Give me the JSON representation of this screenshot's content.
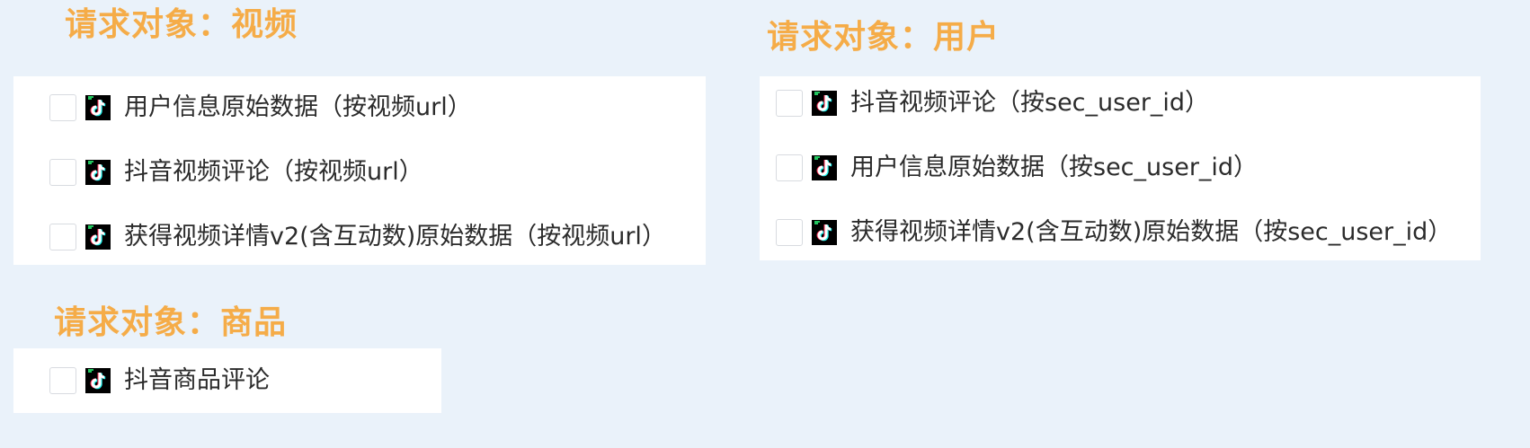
{
  "groups": {
    "video": {
      "title": "请求对象：视频",
      "items": [
        {
          "label": "用户信息原始数据（按视频url）"
        },
        {
          "label": "抖音视频评论（按视频url）"
        },
        {
          "label": "获得视频详情v2(含互动数)原始数据（按视频url）"
        }
      ]
    },
    "user": {
      "title": "请求对象：用户",
      "items": [
        {
          "label": "抖音视频评论（按sec_user_id）"
        },
        {
          "label": "用户信息原始数据（按sec_user_id）"
        },
        {
          "label": "获得视频详情v2(含互动数)原始数据（按sec_user_id）"
        }
      ]
    },
    "product": {
      "title": "请求对象：商品",
      "items": [
        {
          "label": "抖音商品评论"
        }
      ]
    }
  },
  "icons": {
    "item_icon": "tiktok-icon",
    "icon_colors": {
      "background": "#000000",
      "cyan": "#25f4ee",
      "red": "#fe2c55",
      "green": "#22c55e"
    }
  },
  "colors": {
    "title": "#f5ac48",
    "page_background": "#eaf2fa",
    "panel_background": "#ffffff"
  }
}
